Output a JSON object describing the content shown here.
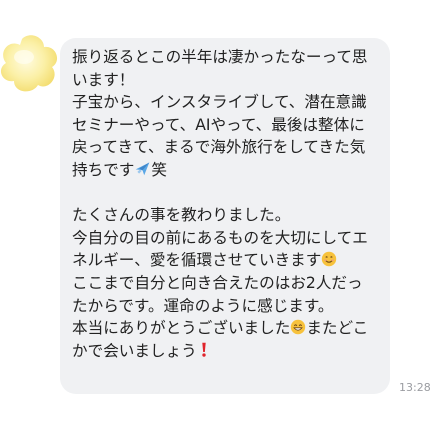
{
  "message": {
    "para1": [
      "振り返るとこの半年は凄かったなーって思",
      "います！",
      "子宝から、インスタライブして、潜在意識",
      "セミナーやって、AIやって、最後は整体に",
      "戻ってきて、まるで海外旅行をしてきた気"
    ],
    "para1_last_before": "持ちです",
    "para1_last_after": "笑",
    "para2_line1": "たくさんの事を教わりました。",
    "para2_line2": "今自分の目の前にあるものを大切にしてエ",
    "para2_line3_before": "ネルギー、愛を循環させていきます",
    "para2_line4": "ここまで自分と向き合えたのはお2人だっ",
    "para2_line5": "たからです。運命のように感じます。",
    "para2_line6_before": "本当にありがとうございました",
    "para2_line6_after": "またどこ",
    "para2_line7_before": "かで会いましょう",
    "emoji": {
      "airplane": "airplane-icon",
      "smile": "smiling-face-icon",
      "grin": "grinning-face-icon",
      "exclamation": "red-exclamation-icon"
    }
  },
  "timestamp": "13:28",
  "colors": {
    "bubble": "#f0f1f3",
    "avatar": "#f9e98a",
    "exclamation": "#e0242b"
  }
}
